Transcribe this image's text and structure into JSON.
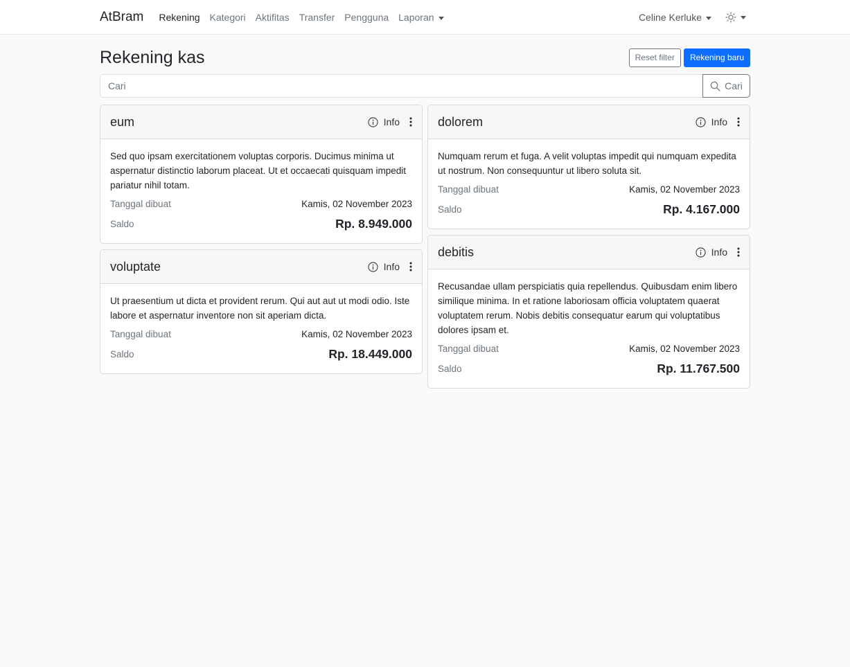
{
  "nav": {
    "brand": "AtBram",
    "links": [
      "Rekening",
      "Kategori",
      "Aktifitas",
      "Transfer",
      "Pengguna",
      "Laporan"
    ],
    "user": "Celine Kerluke"
  },
  "page": {
    "title": "Rekening kas",
    "reset_label": "Reset filter",
    "new_label": "Rekening baru"
  },
  "search": {
    "placeholder": "Cari",
    "button_label": "Cari"
  },
  "labels": {
    "info": "Info",
    "created": "Tanggal dibuat",
    "saldo": "Saldo"
  },
  "accounts": [
    {
      "name": "eum",
      "description": "Sed quo ipsam exercitationem voluptas corporis. Ducimus minima ut aspernatur distinctio laborum placeat. Ut et occaecati quisquam impedit pariatur nihil totam.",
      "created": "Kamis, 02 November 2023",
      "saldo": "Rp. 8.949.000"
    },
    {
      "name": "dolorem",
      "description": "Numquam rerum et fuga. A velit voluptas impedit qui numquam expedita ut nostrum. Non consequuntur ut libero soluta sit.",
      "created": "Kamis, 02 November 2023",
      "saldo": "Rp. 4.167.000"
    },
    {
      "name": "voluptate",
      "description": "Ut praesentium ut dicta et provident rerum. Qui aut aut ut modi odio. Iste labore et aspernatur inventore non sit aperiam dicta.",
      "created": "Kamis, 02 November 2023",
      "saldo": "Rp. 18.449.000"
    },
    {
      "name": "debitis",
      "description": "Recusandae ullam perspiciatis quia repellendus. Quibusdam enim libero similique minima. In et ratione laboriosam officia voluptatem quaerat voluptatem rerum. Nobis debitis consequatur earum qui voluptatibus dolores ipsam et.",
      "created": "Kamis, 02 November 2023",
      "saldo": "Rp. 11.767.500"
    }
  ],
  "colors": {
    "primary": "#0d6efd",
    "secondary": "#6c757d",
    "background": "#fafafa"
  }
}
